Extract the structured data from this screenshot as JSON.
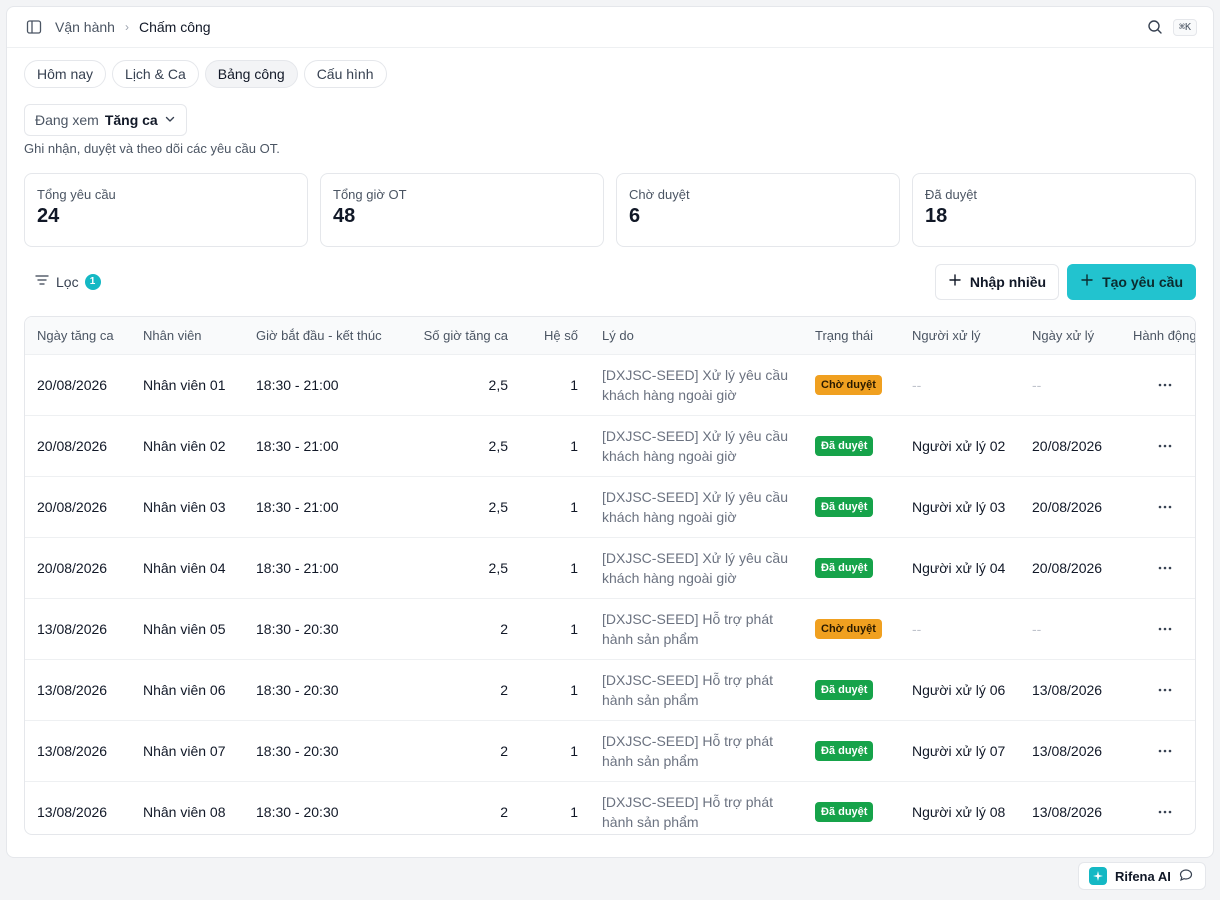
{
  "breadcrumb": {
    "parent": "Vận hành",
    "separator": "›",
    "current": "Chấm công"
  },
  "search": {
    "shortcut": "⌘K"
  },
  "tabs": [
    {
      "label": "Hôm nay"
    },
    {
      "label": "Lịch & Ca"
    },
    {
      "label": "Bảng công",
      "active": true
    },
    {
      "label": "Cấu hình"
    }
  ],
  "view_select": {
    "label": "Đang xem",
    "value": "Tăng ca"
  },
  "subtitle": "Ghi nhận, duyệt và theo dõi các yêu cầu OT.",
  "stats": [
    {
      "label": "Tổng yêu cầu",
      "value": "24"
    },
    {
      "label": "Tổng giờ OT",
      "value": "48"
    },
    {
      "label": "Chờ duyệt",
      "value": "6"
    },
    {
      "label": "Đã duyệt",
      "value": "18"
    }
  ],
  "toolbar": {
    "filter_label": "Lọc",
    "filter_count": "1",
    "import_label": "Nhập nhiều",
    "create_label": "Tạo yêu cầu"
  },
  "table": {
    "columns": [
      "Ngày tăng ca",
      "Nhân viên",
      "Giờ bắt đầu - kết thúc",
      "Số giờ tăng ca",
      "Hệ số",
      "Lý do",
      "Trạng thái",
      "Người xử lý",
      "Ngày xử lý",
      "Hành động"
    ],
    "rows": [
      {
        "date": "20/08/2026",
        "employee": "Nhân viên 01",
        "time": "18:30 - 21:00",
        "hours": "2,5",
        "factor": "1",
        "reason": "[DXJSC-SEED] Xử lý yêu cầu khách hàng ngoài giờ",
        "status": "Chờ duyệt",
        "status_type": "pending",
        "handler": "--",
        "handled_date": "--"
      },
      {
        "date": "20/08/2026",
        "employee": "Nhân viên 02",
        "time": "18:30 - 21:00",
        "hours": "2,5",
        "factor": "1",
        "reason": "[DXJSC-SEED] Xử lý yêu cầu khách hàng ngoài giờ",
        "status": "Đã duyệt",
        "status_type": "approved",
        "handler": "Người xử lý 02",
        "handled_date": "20/08/2026"
      },
      {
        "date": "20/08/2026",
        "employee": "Nhân viên 03",
        "time": "18:30 - 21:00",
        "hours": "2,5",
        "factor": "1",
        "reason": "[DXJSC-SEED] Xử lý yêu cầu khách hàng ngoài giờ",
        "status": "Đã duyệt",
        "status_type": "approved",
        "handler": "Người xử lý 03",
        "handled_date": "20/08/2026"
      },
      {
        "date": "20/08/2026",
        "employee": "Nhân viên 04",
        "time": "18:30 - 21:00",
        "hours": "2,5",
        "factor": "1",
        "reason": "[DXJSC-SEED] Xử lý yêu cầu khách hàng ngoài giờ",
        "status": "Đã duyệt",
        "status_type": "approved",
        "handler": "Người xử lý 04",
        "handled_date": "20/08/2026"
      },
      {
        "date": "13/08/2026",
        "employee": "Nhân viên 05",
        "time": "18:30 - 20:30",
        "hours": "2",
        "factor": "1",
        "reason": "[DXJSC-SEED] Hỗ trợ phát hành sản phẩm",
        "status": "Chờ duyệt",
        "status_type": "pending",
        "handler": "--",
        "handled_date": "--"
      },
      {
        "date": "13/08/2026",
        "employee": "Nhân viên 06",
        "time": "18:30 - 20:30",
        "hours": "2",
        "factor": "1",
        "reason": "[DXJSC-SEED] Hỗ trợ phát hành sản phẩm",
        "status": "Đã duyệt",
        "status_type": "approved",
        "handler": "Người xử lý 06",
        "handled_date": "13/08/2026"
      },
      {
        "date": "13/08/2026",
        "employee": "Nhân viên 07",
        "time": "18:30 - 20:30",
        "hours": "2",
        "factor": "1",
        "reason": "[DXJSC-SEED] Hỗ trợ phát hành sản phẩm",
        "status": "Đã duyệt",
        "status_type": "approved",
        "handler": "Người xử lý 07",
        "handled_date": "13/08/2026"
      },
      {
        "date": "13/08/2026",
        "employee": "Nhân viên 08",
        "time": "18:30 - 20:30",
        "hours": "2",
        "factor": "1",
        "reason": "[DXJSC-SEED] Hỗ trợ phát hành sản phẩm",
        "status": "Đã duyệt",
        "status_type": "approved",
        "handler": "Người xử lý 08",
        "handled_date": "13/08/2026"
      }
    ]
  },
  "assistant": {
    "label": "Rifena AI"
  },
  "colors": {
    "accent": "#22c3cf",
    "pending": "#f0a020",
    "approved": "#16a34a"
  },
  "icons": {
    "sidebar": "sidebar-toggle-icon",
    "search": "search-icon",
    "filter": "filter-icon",
    "plus": "plus-icon",
    "more": "more-horizontal-icon",
    "chevron": "chevron-down-icon",
    "ai": "sparkle-icon",
    "chat": "chat-icon"
  }
}
